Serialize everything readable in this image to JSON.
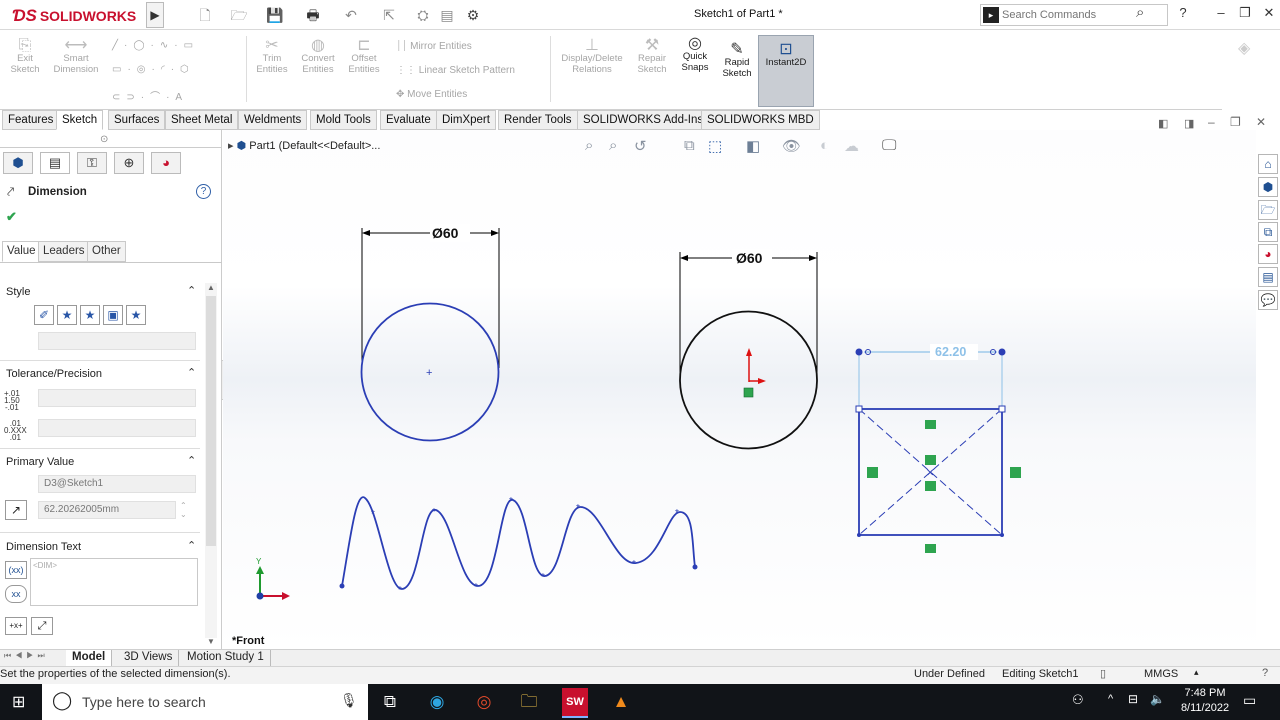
{
  "app": {
    "logo_ds": "ƊS",
    "logo_text": "SOLIDWORKS",
    "document_title": "Sketch1 of Part1 *"
  },
  "search": {
    "placeholder": "Search Commands"
  },
  "command_manager": {
    "exit_sketch": "Exit\nSketch",
    "smart_dimension": "Smart\nDimension",
    "trim_entities": "Trim\nEntities",
    "convert_entities": "Convert\nEntities",
    "offset_entities": "Offset\nEntities",
    "mirror_entities": "Mirror Entities",
    "linear_sketch_pattern": "Linear Sketch Pattern",
    "move_entities": "Move Entities",
    "display_delete_relations": "Display/Delete\nRelations",
    "repair_sketch": "Repair\nSketch",
    "quick_snaps": "Quick\nSnaps",
    "rapid_sketch": "Rapid\nSketch",
    "instant2d": "Instant2D"
  },
  "tabs": [
    "Features",
    "Sketch",
    "Surfaces",
    "Sheet Metal",
    "Weldments",
    "Mold Tools",
    "Evaluate",
    "DimXpert",
    "Render Tools",
    "SOLIDWORKS Add-Ins",
    "SOLIDWORKS MBD"
  ],
  "active_tab": "Sketch",
  "property_manager": {
    "title": "Dimension",
    "subtabs": [
      "Value",
      "Leaders",
      "Other"
    ],
    "style_label": "Style",
    "tolerance_label": "Tolerance/Precision",
    "tol_icon_1": "+.01\n1.50\n-.01",
    "tol_icon_2": ".01\n0.XXX\n.01",
    "primary_value_label": "Primary Value",
    "primary_name": "D3@Sketch1",
    "primary_value": "62.20262005mm",
    "dimension_text_label": "Dimension Text",
    "dimension_text_value": "<DIM>",
    "text_btn_1": "(xx)",
    "text_btn_2": "xx",
    "text_btn_3": "+x+"
  },
  "feature_tree": {
    "breadcrumb": "Part1  (Default<<Default>..."
  },
  "sketch": {
    "dim_left": "Ø60",
    "dim_right": "Ø60",
    "dim_rect": "62.20",
    "view_label": "*Front",
    "triad_y": "Y"
  },
  "bottom_tabs": [
    "Model",
    "3D Views",
    "Motion Study 1"
  ],
  "active_bottom_tab": "Model",
  "status": {
    "message": "Set the properties of the selected dimension(s).",
    "state": "Under Defined",
    "editing": "Editing Sketch1",
    "units": "MMGS"
  },
  "taskbar": {
    "search_placeholder": "Type here to search",
    "time": "7:48 PM",
    "date": "8/11/2022"
  },
  "colors": {
    "accent_red": "#c8102e",
    "sketch_blue": "#2b3eb5",
    "selected_dim": "#8ec1e8",
    "relation_green": "#2ea44f"
  }
}
